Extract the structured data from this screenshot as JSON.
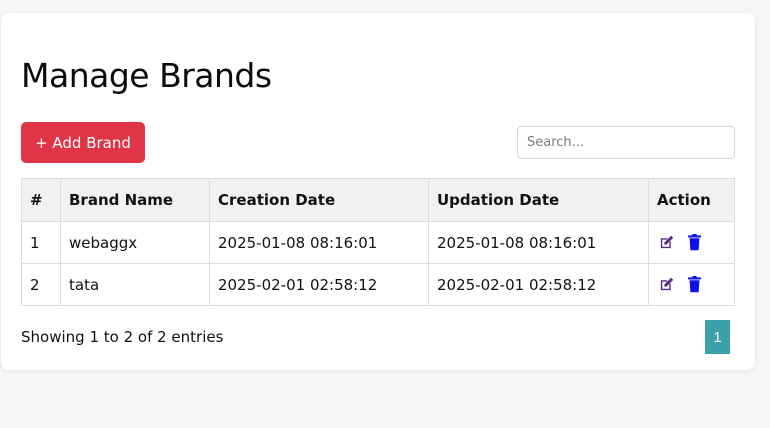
{
  "page": {
    "title": "Manage Brands"
  },
  "toolbar": {
    "add_label": "+ Add Brand",
    "search_placeholder": "Search..."
  },
  "table": {
    "headers": [
      "#",
      "Brand Name",
      "Creation Date",
      "Updation Date",
      "Action"
    ],
    "rows": [
      {
        "index": "1",
        "brand": "webaggx",
        "created": "2025-01-08 08:16:01",
        "updated": "2025-01-08 08:16:01"
      },
      {
        "index": "2",
        "brand": "tata",
        "created": "2025-02-01 02:58:12",
        "updated": "2025-02-01 02:58:12"
      }
    ],
    "action_icons": [
      "edit-icon",
      "trash-icon"
    ]
  },
  "footer": {
    "info": "Showing 1 to 2 of 2 entries",
    "current_page": "1"
  },
  "colors": {
    "add_button": "#e03546",
    "edit_icon": "#5a2a82",
    "delete_icon": "#1010e8",
    "pagination": "#3ba0aa"
  }
}
